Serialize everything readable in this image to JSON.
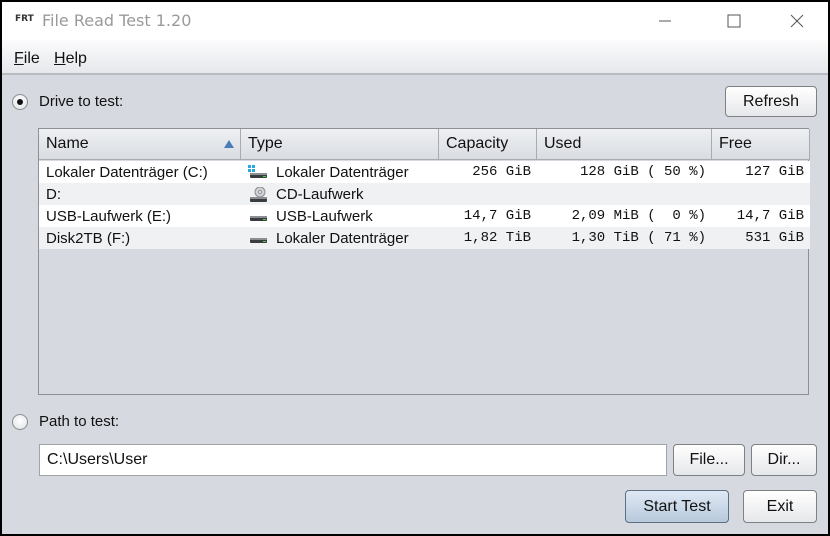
{
  "window": {
    "app_icon_text": "FRT",
    "title": "File Read Test 1.20",
    "controls": [
      "minimize",
      "maximize",
      "close"
    ]
  },
  "menu": {
    "items": [
      {
        "label": "File",
        "mnemonic": "F"
      },
      {
        "label": "Help",
        "mnemonic": "H"
      }
    ]
  },
  "drive_section": {
    "radio_label": "Drive to test:",
    "selected": true,
    "refresh_label": "Refresh"
  },
  "table": {
    "columns": [
      "Name",
      "Type",
      "Capacity",
      "Used",
      "Free"
    ],
    "sort_column": "Name",
    "sort_direction": "ascending",
    "rows": [
      {
        "name": "Lokaler Datenträger (C:)",
        "icon": "windows-drive-icon",
        "type": "Lokaler Datenträger",
        "capacity": "256 GiB",
        "used": "128 GiB ( 50 %)",
        "free": "127 GiB"
      },
      {
        "name": "D:",
        "icon": "cd-drive-icon",
        "type": "CD-Laufwerk",
        "capacity": "",
        "used": "",
        "free": ""
      },
      {
        "name": "USB-Laufwerk (E:)",
        "icon": "usb-drive-icon",
        "type": "USB-Laufwerk",
        "capacity": "14,7 GiB",
        "used": "2,09 MiB (  0 %)",
        "free": "14,7 GiB"
      },
      {
        "name": "Disk2TB (F:)",
        "icon": "hard-drive-icon",
        "type": "Lokaler Datenträger",
        "capacity": "1,82 TiB",
        "used": "1,30 TiB ( 71 %)",
        "free": "531 GiB"
      }
    ]
  },
  "path_section": {
    "radio_label": "Path to test:",
    "selected": false,
    "path_value": "C:\\Users\\User",
    "file_button": "File...",
    "dir_button": "Dir..."
  },
  "footer": {
    "start_label": "Start Test",
    "exit_label": "Exit"
  },
  "colors": {
    "window_bg": "#d6d9df",
    "sort_arrow": "#4a7cb8",
    "primary_button": "#b7c9dc"
  }
}
